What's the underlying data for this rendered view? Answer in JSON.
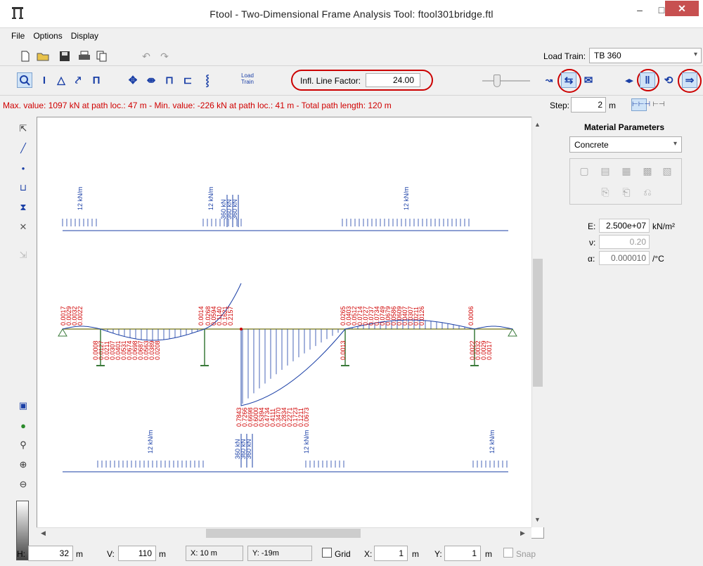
{
  "window": {
    "title": "Ftool - Two-Dimensional Frame Analysis Tool: ftool301bridge.ftl",
    "app_icon": "frame-app-icon",
    "minimize": "–",
    "maximize": "□",
    "close": "✕"
  },
  "menu": [
    "File",
    "Options",
    "Display"
  ],
  "toolbar1": {
    "icons": [
      "new-file-icon",
      "open-folder-icon",
      "save-icon",
      "print-icon",
      "copy-icon",
      "undo-icon",
      "redo-icon"
    ],
    "load_train_label": "Load Train:",
    "load_train_value": "TB 360"
  },
  "toolbar2": {
    "icons_left": [
      "influence-line-icon",
      "section-icon",
      "support-icon",
      "load-icon",
      "frame-icon"
    ],
    "icons_mid": [
      "moving-load-icon",
      "moving-load-double-icon",
      "vehicle-icon",
      "vehicle-single-icon",
      "train-icon"
    ],
    "load_train_button": "Load\nTrain",
    "infl_factor_label": "Infl. Line Factor:",
    "infl_factor_value": "24.00",
    "icons_right": [
      "scale-icon",
      "envelope-icon",
      "export-icon",
      "reverse-icon",
      "path-icon",
      "flip-icon",
      "animate-icon"
    ]
  },
  "status": {
    "text": "Max. value: 1097 kN at path loc.: 47 m  -  Min. value: -226 kN at path loc.: 41 m  -  Total path length: 120 m",
    "step_label": "Step:",
    "step_value": "2",
    "step_unit": "m"
  },
  "material": {
    "title": "Material Parameters",
    "type": "Concrete",
    "E_label": "E:",
    "E_value": "2.500e+07",
    "E_unit": "kN/m²",
    "nu_label": "ν:",
    "nu_value": "0.20",
    "alpha_label": "α:",
    "alpha_value": "0.000010",
    "alpha_unit": "/°C"
  },
  "bottom": {
    "H_label": "H:",
    "H_value": "32",
    "H_unit": "m",
    "V_label": "V:",
    "V_value": "110",
    "V_unit": "m",
    "X_readout": "X: 10 m",
    "Y_readout": "Y: -19m",
    "grid_label": "Grid",
    "gx_label": "X:",
    "gx_value": "1",
    "gx_unit": "m",
    "gy_label": "Y:",
    "gy_value": "1",
    "gy_unit": "m",
    "snap_label": "Snap"
  },
  "diagram": {
    "load_top": {
      "dist_labels": [
        "12 kN/m",
        "12 kN/m",
        "12 kN/m"
      ],
      "point_labels": [
        "360 kN",
        "360 kN",
        "360 kN"
      ]
    },
    "load_bottom": {
      "dist_labels": [
        "12 kN/m",
        "12 kN/m",
        "12 kN/m"
      ],
      "point_labels": [
        "360 kN",
        "360 kN",
        "360 kN"
      ]
    },
    "upper_values": [
      "0.0017",
      "0.0029",
      "0.0032",
      "0.0022",
      "0.0014",
      "0.0268",
      "0.0594",
      "0.1140",
      "0.1621",
      "0.2157",
      "0.0265",
      "0.0403",
      "0.0512",
      "0.0714",
      "0.0727",
      "0.0737",
      "0.0734",
      "0.0749",
      "0.0679",
      "0.0586",
      "0.0609",
      "0.0407",
      "0.0307",
      "0.0211",
      "0.0126",
      "0.0006"
    ],
    "lower_values": [
      "0.0008",
      "0.0127",
      "0.0211",
      "0.0307",
      "0.0401",
      "0.0531",
      "0.0674",
      "0.0698",
      "0.0687",
      "0.0563",
      "0.0389",
      "0.0208",
      "0.7843",
      "0.7266",
      "0.6698",
      "0.6000",
      "0.5394",
      "0.4734",
      "0.4111",
      "0.3470",
      "0.2834",
      "0.2271",
      "0.1723",
      "0.1211",
      "0.0673",
      "0.0013",
      "0.0022",
      "0.0032",
      "0.0029",
      "0.0017"
    ]
  }
}
